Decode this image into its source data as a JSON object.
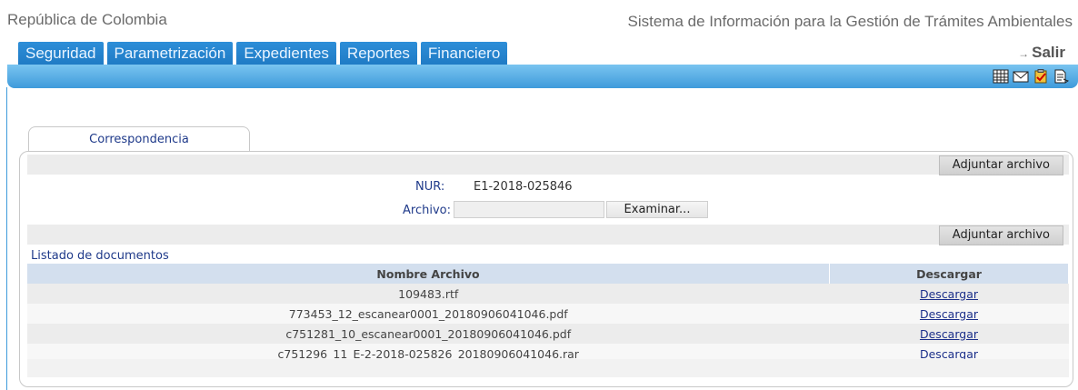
{
  "header": {
    "left_title": "República de Colombia",
    "right_title": "Sistema de Información para la Gestión de Trámites Ambientales",
    "logout_label": "Salir"
  },
  "nav": {
    "tabs": [
      {
        "label": "Seguridad"
      },
      {
        "label": "Parametrización"
      },
      {
        "label": "Expedientes"
      },
      {
        "label": "Reportes"
      },
      {
        "label": "Financiero"
      }
    ]
  },
  "toolbar": {
    "icons": [
      "calendar-icon",
      "mail-icon",
      "clipboard-icon",
      "document-icon"
    ]
  },
  "card": {
    "tab_label": "Correspondencia",
    "attach_button_label": "Adjuntar archivo",
    "nur_label": "NUR:",
    "nur_value": "E1-2018-025846",
    "file_label": "Archivo:",
    "file_input_value": "",
    "browse_label": "Examinar...",
    "list_title": "Listado de documentos",
    "table": {
      "headers": [
        "Nombre Archivo",
        "Descargar"
      ],
      "rows": [
        {
          "name": "109483.rtf",
          "action": "Descargar"
        },
        {
          "name": "773453_12_escanear0001_20180906041046.pdf",
          "action": "Descargar"
        },
        {
          "name": "c751281_10_escanear0001_20180906041046.pdf",
          "action": "Descargar"
        },
        {
          "name": "c751296_11_E-2-2018-025826_20180906041046.rar",
          "action": "Descargar"
        }
      ]
    }
  },
  "colors": {
    "nav_tab": "#1f7ac4",
    "bluebar": "#3f9bdb",
    "header_row": "#d3dfee",
    "link": "#1b2f8a"
  }
}
